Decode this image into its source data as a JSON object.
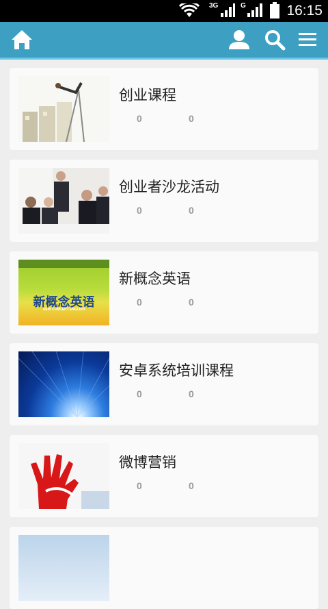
{
  "status_bar": {
    "network_a": "3G",
    "network_b": "G",
    "time": "16:15"
  },
  "app_bar": {
    "home_icon": "home-icon",
    "user_icon": "user-icon",
    "search_icon": "search-icon",
    "menu_icon": "menu-icon",
    "background": "#3da0c2"
  },
  "courses": [
    {
      "title": "创业课程",
      "stat_1": "0",
      "stat_2": "0",
      "thumb": "pole-vault-photo"
    },
    {
      "title": "创业者沙龙活动",
      "stat_1": "0",
      "stat_2": "0",
      "thumb": "business-meeting-photo"
    },
    {
      "title": "新概念英语",
      "stat_1": "0",
      "stat_2": "0",
      "thumb": "new-concept-english-cover",
      "thumb_text": "新概念英语",
      "thumb_subtext": "NEW CONCEPT ENGLISH"
    },
    {
      "title": "安卓系统培训课程",
      "stat_1": "0",
      "stat_2": "0",
      "thumb": "blue-light-rays-image"
    },
    {
      "title": "微博营销",
      "stat_1": "0",
      "stat_2": "0",
      "thumb": "red-hand-image"
    },
    {
      "title": "",
      "stat_1": "",
      "stat_2": "",
      "thumb": "partial-item-image"
    }
  ]
}
